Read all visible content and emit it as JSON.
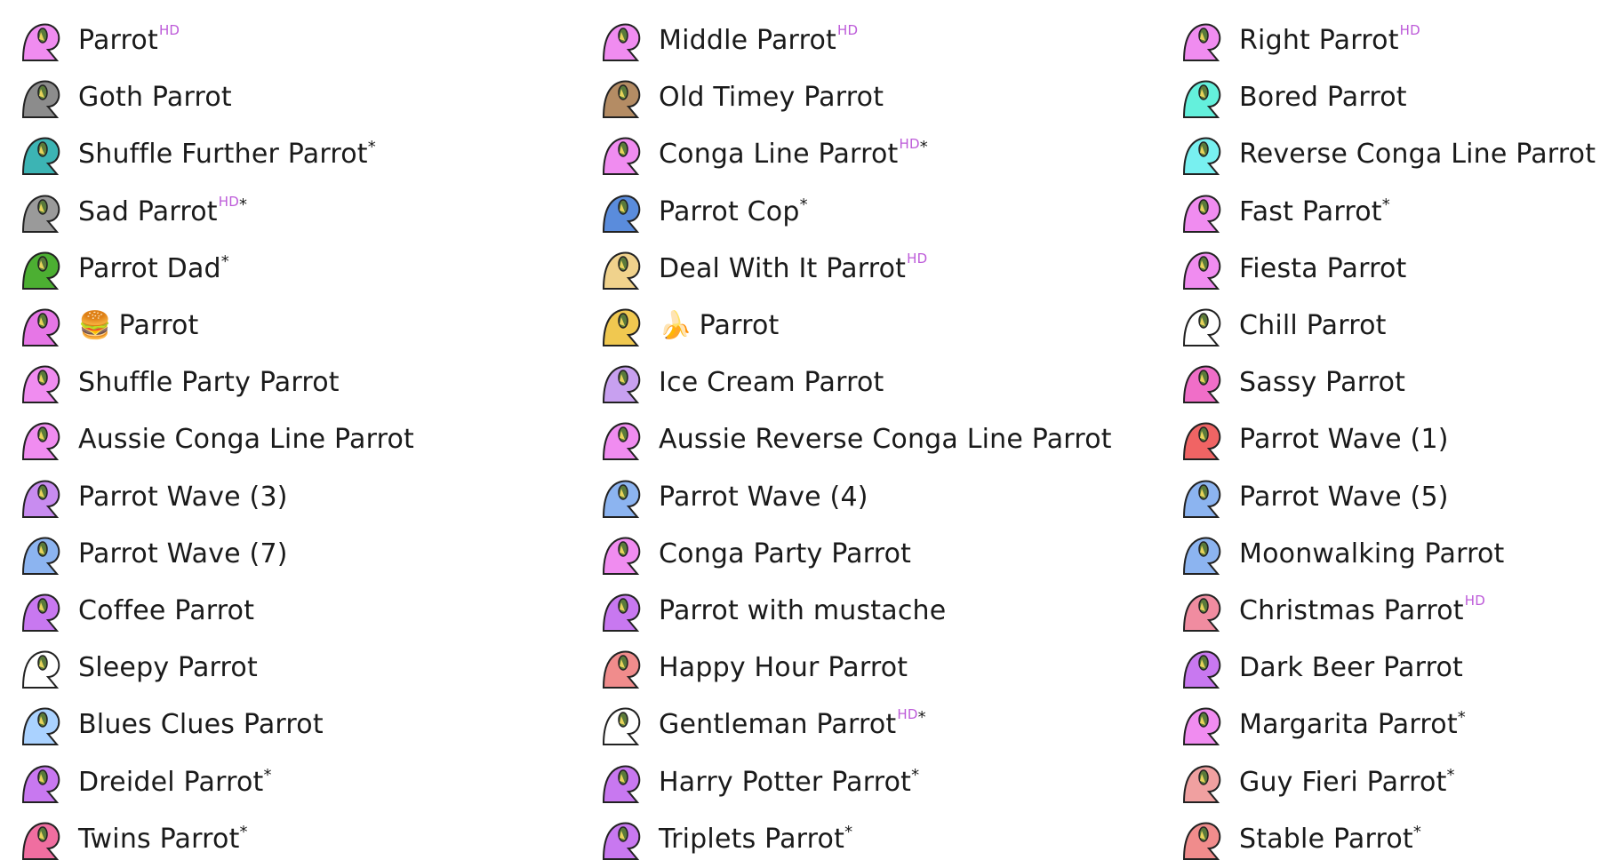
{
  "marker_hd": "HD",
  "marker_star": "*",
  "columns": [
    {
      "items": [
        {
          "name": "Parrot",
          "hd": true,
          "star": false,
          "icon": "parrot-icon",
          "color": "#f08cf0"
        },
        {
          "name": "Goth Parrot",
          "hd": false,
          "star": false,
          "icon": "goth-parrot-icon",
          "color": "#8c8c8c"
        },
        {
          "name": "Shuffle Further Parrot",
          "hd": false,
          "star": true,
          "icon": "shuffle-further-parrot-icon",
          "color": "#3cb4b4"
        },
        {
          "name": "Sad Parrot",
          "hd": true,
          "star": true,
          "icon": "sad-parrot-icon",
          "color": "#9a9a9a"
        },
        {
          "name": "Parrot Dad",
          "hd": false,
          "star": true,
          "icon": "parrot-dad-icon",
          "color": "#4caf32"
        },
        {
          "name": "Parrot",
          "prefix": "🍔",
          "hd": false,
          "star": false,
          "icon": "burger-parrot-icon",
          "color": "#e676e6"
        },
        {
          "name": "Shuffle Party Parrot",
          "hd": false,
          "star": false,
          "icon": "shuffle-party-parrot-icon",
          "color": "#f08cf0"
        },
        {
          "name": "Aussie Conga Line Parrot",
          "hd": false,
          "star": false,
          "icon": "aussie-conga-line-parrot-icon",
          "color": "#f08cf0"
        },
        {
          "name": "Parrot Wave (3)",
          "hd": false,
          "star": false,
          "icon": "parrot-wave-3-icon",
          "color": "#c88cf0"
        },
        {
          "name": "Parrot Wave (7)",
          "hd": false,
          "star": false,
          "icon": "parrot-wave-7-icon",
          "color": "#8cb4f0"
        },
        {
          "name": "Coffee Parrot",
          "hd": false,
          "star": false,
          "icon": "coffee-parrot-icon",
          "color": "#c878f0"
        },
        {
          "name": "Sleepy Parrot",
          "hd": false,
          "star": false,
          "icon": "sleepy-parrot-icon",
          "color": "#ffffff"
        },
        {
          "name": "Blues Clues Parrot",
          "hd": false,
          "star": false,
          "icon": "blues-clues-parrot-icon",
          "color": "#aad2ff"
        },
        {
          "name": "Dreidel Parrot",
          "hd": false,
          "star": true,
          "icon": "dreidel-parrot-icon",
          "color": "#c878f0"
        },
        {
          "name": "Twins Parrot",
          "hd": false,
          "star": true,
          "icon": "twins-parrot-icon",
          "color": "#f06ea0"
        }
      ]
    },
    {
      "items": [
        {
          "name": "Middle Parrot",
          "hd": true,
          "star": false,
          "icon": "middle-parrot-icon",
          "color": "#f08cf0"
        },
        {
          "name": "Old Timey Parrot",
          "hd": false,
          "star": false,
          "icon": "old-timey-parrot-icon",
          "color": "#b48c64"
        },
        {
          "name": "Conga Line Parrot",
          "hd": true,
          "star": true,
          "icon": "conga-line-parrot-icon",
          "color": "#f08cf0"
        },
        {
          "name": "Parrot Cop",
          "hd": false,
          "star": true,
          "icon": "parrot-cop-icon",
          "color": "#5a8cdc"
        },
        {
          "name": "Deal With It Parrot",
          "hd": true,
          "star": false,
          "icon": "deal-with-it-parrot-icon",
          "color": "#f0d28c"
        },
        {
          "name": "Parrot",
          "prefix": "🍌",
          "hd": false,
          "star": false,
          "icon": "banana-parrot-icon",
          "color": "#f0c850"
        },
        {
          "name": "Ice Cream Parrot",
          "hd": false,
          "star": false,
          "icon": "ice-cream-parrot-icon",
          "color": "#c8a0f0"
        },
        {
          "name": "Aussie Reverse Conga Line Parrot",
          "hd": false,
          "star": false,
          "icon": "aussie-reverse-conga-line-parrot-icon",
          "color": "#f08cf0"
        },
        {
          "name": "Parrot Wave (4)",
          "hd": false,
          "star": false,
          "icon": "parrot-wave-4-icon",
          "color": "#8cb4f0"
        },
        {
          "name": "Conga Party Parrot",
          "hd": false,
          "star": false,
          "icon": "conga-party-parrot-icon",
          "color": "#f08cf0"
        },
        {
          "name": "Parrot with mustache",
          "hd": false,
          "star": false,
          "icon": "parrot-with-mustache-icon",
          "color": "#c878f0"
        },
        {
          "name": "Happy Hour Parrot",
          "hd": false,
          "star": false,
          "icon": "happy-hour-parrot-icon",
          "color": "#f08c8c"
        },
        {
          "name": "Gentleman Parrot",
          "hd": true,
          "star": true,
          "icon": "gentleman-parrot-icon",
          "color": "#ffffff"
        },
        {
          "name": "Harry Potter Parrot",
          "hd": false,
          "star": true,
          "icon": "harry-potter-parrot-icon",
          "color": "#c878f0"
        },
        {
          "name": "Triplets Parrot",
          "hd": false,
          "star": true,
          "icon": "triplets-parrot-icon",
          "color": "#c878f0"
        }
      ]
    },
    {
      "items": [
        {
          "name": "Right Parrot",
          "hd": true,
          "star": false,
          "icon": "right-parrot-icon",
          "color": "#f08cf0"
        },
        {
          "name": "Bored Parrot",
          "hd": false,
          "star": false,
          "icon": "bored-parrot-icon",
          "color": "#64f0dc"
        },
        {
          "name": "Reverse Conga Line Parrot",
          "hd": false,
          "star": false,
          "icon": "reverse-conga-line-parrot-icon",
          "color": "#78f0f0"
        },
        {
          "name": "Fast Parrot",
          "hd": false,
          "star": true,
          "icon": "fast-parrot-icon",
          "color": "#f08cf0"
        },
        {
          "name": "Fiesta Parrot",
          "hd": false,
          "star": false,
          "icon": "fiesta-parrot-icon",
          "color": "#f08cf0"
        },
        {
          "name": "Chill Parrot",
          "hd": false,
          "star": false,
          "icon": "chill-parrot-icon",
          "color": "#ffffff"
        },
        {
          "name": "Sassy Parrot",
          "hd": false,
          "star": false,
          "icon": "sassy-parrot-icon",
          "color": "#f06ec8"
        },
        {
          "name": "Parrot Wave (1)",
          "hd": false,
          "star": false,
          "icon": "parrot-wave-1-icon",
          "color": "#f06464"
        },
        {
          "name": "Parrot Wave (5)",
          "hd": false,
          "star": false,
          "icon": "parrot-wave-5-icon",
          "color": "#8cb4f0"
        },
        {
          "name": "Moonwalking Parrot",
          "hd": false,
          "star": false,
          "icon": "moonwalking-parrot-icon",
          "color": "#8cb4f0"
        },
        {
          "name": "Christmas Parrot",
          "hd": true,
          "star": false,
          "icon": "christmas-parrot-icon",
          "color": "#f08ca0"
        },
        {
          "name": "Dark Beer Parrot",
          "hd": false,
          "star": false,
          "icon": "dark-beer-parrot-icon",
          "color": "#c878f0"
        },
        {
          "name": "Margarita Parrot",
          "hd": false,
          "star": true,
          "icon": "margarita-parrot-icon",
          "color": "#f08cf0"
        },
        {
          "name": "Guy Fieri Parrot",
          "hd": false,
          "star": true,
          "icon": "guy-fieri-parrot-icon",
          "color": "#f0a0a0"
        },
        {
          "name": "Stable Parrot",
          "hd": false,
          "star": true,
          "icon": "stable-parrot-icon",
          "color": "#f08c8c"
        }
      ]
    }
  ]
}
